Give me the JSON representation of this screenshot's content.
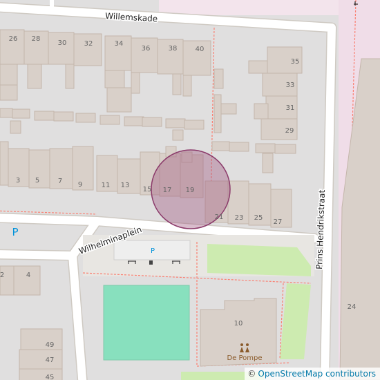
{
  "map": {
    "streets": {
      "willemskade": "Willemskade",
      "wilhelminaplein": "Wilhelminaplein",
      "prins_hendrikstraat": "Prins Hendrikstraat"
    },
    "parking_symbol": "P",
    "poi": {
      "name": "De Pompe",
      "icon": "community-centre-icon"
    },
    "house_numbers": {
      "n26": "26",
      "n28": "28",
      "n30": "30",
      "n32": "32",
      "n34": "34",
      "n36": "36",
      "n38": "38",
      "n40": "40",
      "n35": "35",
      "n33": "33",
      "n31": "31",
      "n29": "29",
      "n3": "3",
      "n5": "5",
      "n7": "7",
      "n9": "9",
      "n11": "11",
      "n13": "13",
      "n15": "15",
      "n17": "17",
      "n19": "19",
      "n21": "21",
      "n23": "23",
      "n25": "25",
      "n27": "27",
      "n2": "2",
      "n4": "4",
      "n10": "10",
      "n24": "24",
      "n49": "49",
      "n47": "47",
      "n45": "45"
    },
    "marker": {
      "type": "circle",
      "fill": "#a0587f",
      "opacity": 0.4
    },
    "colors": {
      "building": "#d9d0c9",
      "building_outline": "#c4b6ab",
      "road": "#ffffff",
      "path": "#fa8072",
      "pitch": "#88e0be",
      "grass": "#cdebb0",
      "parking": "#eeeeee",
      "residential": "#e0dfdf",
      "school": "#ffffe5"
    }
  },
  "attribution": {
    "symbol": "©",
    "text": "OpenStreetMap contributors"
  }
}
